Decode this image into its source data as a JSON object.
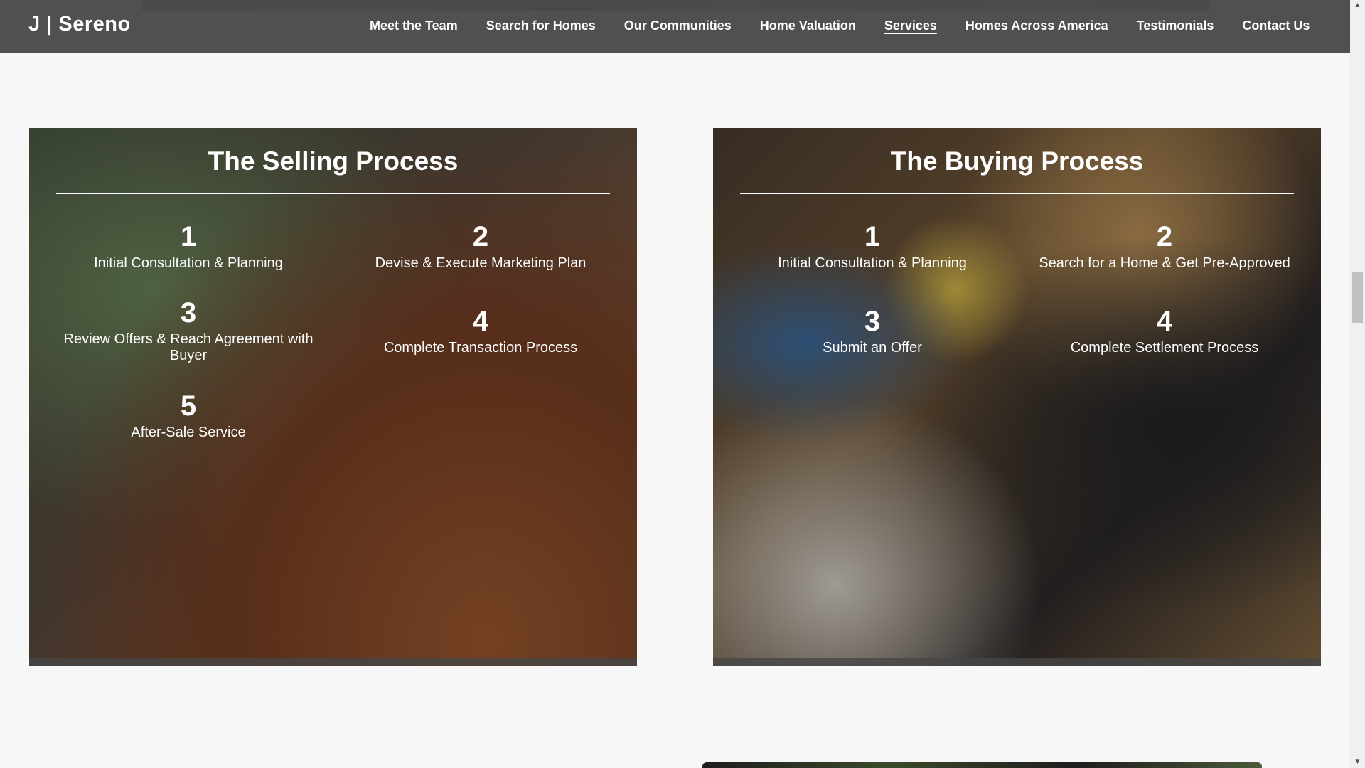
{
  "header": {
    "brand": "J | Sereno",
    "nav": [
      {
        "label": "Meet the Team"
      },
      {
        "label": "Search for Homes"
      },
      {
        "label": "Our Communities"
      },
      {
        "label": "Home Valuation"
      },
      {
        "label": "Services",
        "active": true
      },
      {
        "label": "Homes Across America"
      },
      {
        "label": "Testimonials"
      },
      {
        "label": "Contact Us"
      }
    ]
  },
  "selling": {
    "title": "The Selling Process",
    "steps": [
      {
        "num": "1",
        "label": "Initial Consultation & Planning"
      },
      {
        "num": "2",
        "label": "Devise & Execute Marketing Plan"
      },
      {
        "num": "3",
        "label": "Review Offers & Reach Agreement with Buyer"
      },
      {
        "num": "4",
        "label": "Complete Transaction Process"
      },
      {
        "num": "5",
        "label": "After-Sale Service"
      }
    ]
  },
  "buying": {
    "title": "The Buying Process",
    "steps": [
      {
        "num": "1",
        "label": "Initial Consultation & Planning"
      },
      {
        "num": "2",
        "label": "Search for a Home & Get Pre-Approved"
      },
      {
        "num": "3",
        "label": "Submit an Offer"
      },
      {
        "num": "4",
        "label": "Complete Settlement Process"
      }
    ]
  },
  "colors": {
    "navbar": "#4a4a4a",
    "page_background": "#f7f7f7",
    "text_light": "#ffffff"
  }
}
